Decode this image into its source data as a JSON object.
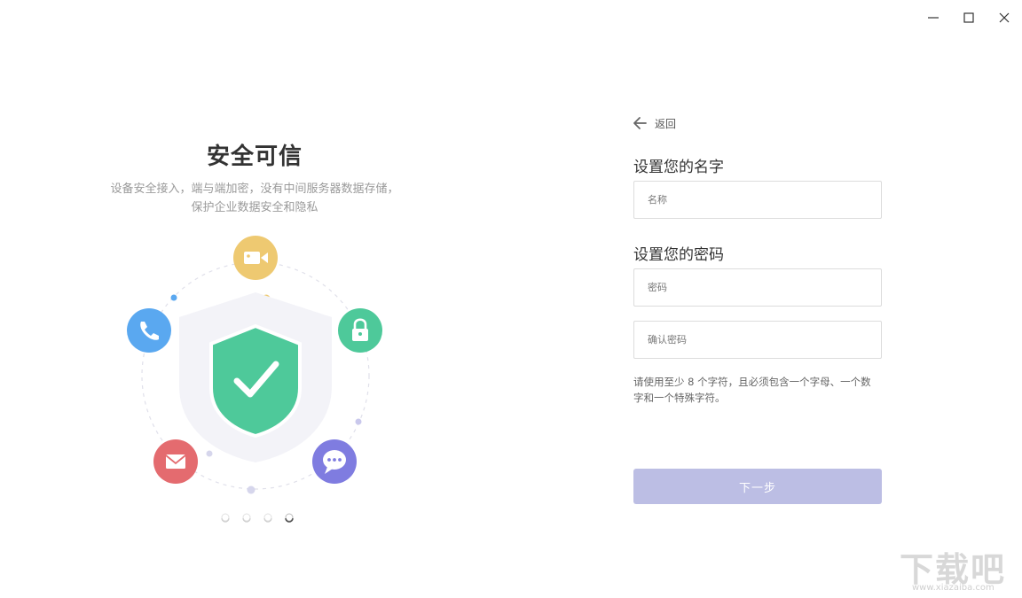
{
  "window_controls": {
    "minimize_icon": "minimize-icon",
    "maximize_icon": "maximize-icon",
    "close_icon": "close-icon"
  },
  "hero": {
    "title": "安全可信",
    "description_line1": "设备安全接入，端与端加密，没有中间服务器数据存储，",
    "description_line2": "保护企业数据安全和隐私",
    "icons": [
      "video-icon",
      "phone-icon",
      "lock-icon",
      "mail-icon",
      "chat-icon",
      "shield-check-icon"
    ],
    "colors": {
      "video": "#eec971",
      "phone": "#5aa8f0",
      "lock": "#4ec99a",
      "mail": "#e46b6f",
      "chat": "#7f7ce0",
      "shield": "#4ec99a"
    },
    "carousel": {
      "pages": 4,
      "active": 4
    }
  },
  "form": {
    "back_label": "返回",
    "name_section": "设置您的名字",
    "name_placeholder": "名称",
    "password_section": "设置您的密码",
    "password_placeholder": "密码",
    "confirm_placeholder": "确认密码",
    "hint_line1": "请使用至少 8 个字符，且必须包含一个字母、一个数",
    "hint_line2": "字和一个特殊字符。",
    "next_label": "下一步",
    "next_color": "#bcbee4"
  },
  "watermark": {
    "text": "下载吧",
    "url": "www.xiazaiba.com"
  }
}
